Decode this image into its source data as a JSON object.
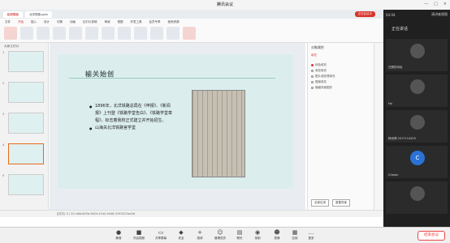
{
  "window": {
    "title": "腾讯会议",
    "time": "04:04",
    "share_label": "演讲者视图"
  },
  "wps": {
    "tabs": [
      "稻壳模板",
      "北洋铁路.pptx"
    ],
    "meeting_pill": "正在会议中",
    "menu": [
      "文件",
      "开始",
      "插入",
      "设计",
      "切换",
      "动画",
      "幻灯片放映",
      "审阅",
      "视图",
      "开发工具",
      "会员专享",
      "稻壳资源"
    ],
    "thumb_header": "大纲  幻灯片",
    "thumb_numbers": [
      "1",
      "2",
      "3",
      "4",
      "5"
    ]
  },
  "slide": {
    "title": "榆关始创",
    "bullets": [
      "1896年，北洋铁路总局在《申报》、《新闻报》上刊登《铁路学堂告白》、《铁路学堂章程》，标志着我校正式建立并开始招生。",
      "山海关北洋铁路官学堂"
    ]
  },
  "status": {
    "text": "幻灯片 4 / 20   c6dcd03b-5624-47a4-9448-3193017ae5d"
  },
  "props": {
    "title": "对象属性",
    "tab": "填充",
    "options": [
      "纯色填充",
      "渐变填充",
      "图片或纹理填充",
      "图案填充",
      "隐藏背景图形"
    ],
    "selected": 0,
    "buttons": [
      "全部应用",
      "重置背景"
    ]
  },
  "participants": {
    "header": "正在讲话",
    "names": [
      "日照的鸿毛",
      "Ho",
      "杨世博 2017114203",
      "Charon"
    ]
  },
  "toolbar": {
    "items": [
      "静音",
      "开启视频",
      "共享屏幕",
      "安全",
      "邀请",
      "管理成员",
      "聊天",
      "录制",
      "表情",
      "应用",
      "更多"
    ],
    "end_button": "结束会议"
  }
}
